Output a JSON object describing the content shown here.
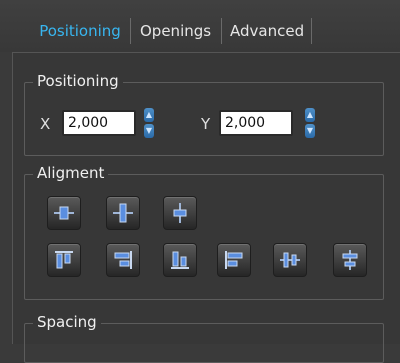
{
  "tabs": [
    {
      "label": "Positioning",
      "active": true
    },
    {
      "label": "Openings",
      "active": false
    },
    {
      "label": "Advanced",
      "active": false
    }
  ],
  "positioning": {
    "title": "Positioning",
    "x_label": "X",
    "x_value": "2,000",
    "y_label": "Y",
    "y_value": "2,000"
  },
  "alignment": {
    "title": "Aligment",
    "row1_icons": [
      "align-center-icon",
      "align-middle-icon",
      "align-center-vertical-icon"
    ],
    "row2_icons": [
      "align-top-icon",
      "align-right-icon",
      "align-bottom-icon",
      "align-left-icon",
      "distribute-horizontal-icon",
      "distribute-vertical-icon"
    ]
  },
  "spacing": {
    "title": "Spacing"
  },
  "colors": {
    "accent": "#38b6f0",
    "background": "#3a3a3a",
    "icon_blue": "#5a8ee0"
  }
}
